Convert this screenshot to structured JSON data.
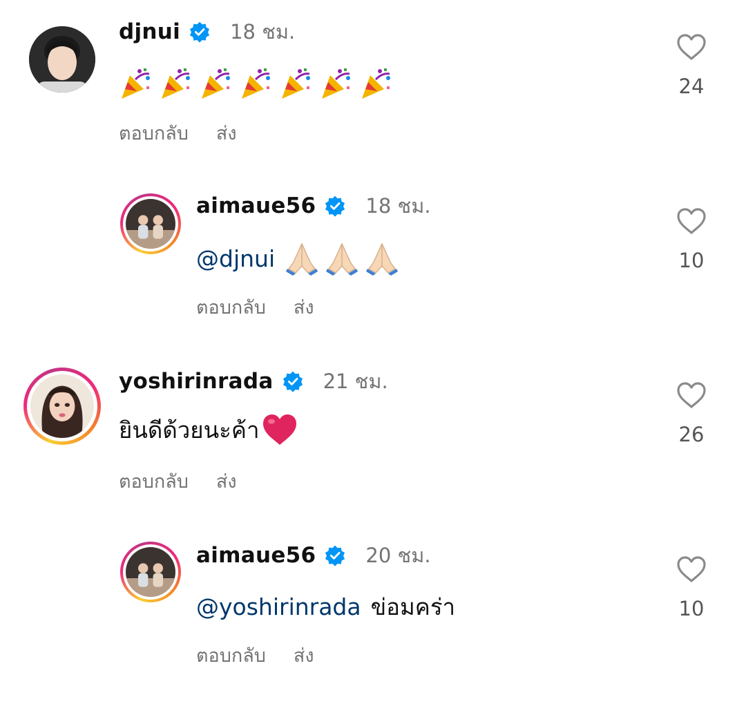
{
  "comments": [
    {
      "username": "djnui",
      "time": "18 ชม.",
      "text": "🎉🎉🎉🎉🎉🎉🎉",
      "likes": "24",
      "reply_label": "ตอบกลับ",
      "send_label": "ส่ง"
    },
    {
      "username": "aimaue56",
      "time": "18 ชม.",
      "mention": "@djnui",
      "text": "🙏🏻🙏🏻🙏🏻",
      "likes": "10",
      "reply_label": "ตอบกลับ",
      "send_label": "ส่ง"
    },
    {
      "username": "yoshirinrada",
      "time": "21 ชม.",
      "text": "ยินดีด้วยนะค้า",
      "likes": "26",
      "reply_label": "ตอบกลับ",
      "send_label": "ส่ง"
    },
    {
      "username": "aimaue56",
      "time": "20 ชม.",
      "mention": "@yoshirinrada",
      "text": "ข่อมคร่า",
      "likes": "10",
      "reply_label": "ตอบกลับ",
      "send_label": "ส่ง"
    }
  ],
  "icons": {
    "verified": "verified-badge-icon",
    "like": "heart-outline-icon",
    "party": "party-popper-emoji",
    "pray": "folded-hands-emoji",
    "heart": "red-heart-emoji"
  },
  "colors": {
    "verified": "#0095f6",
    "mention": "#00376b",
    "secondary": "#737373",
    "heart_emoji": "#e0245e"
  }
}
